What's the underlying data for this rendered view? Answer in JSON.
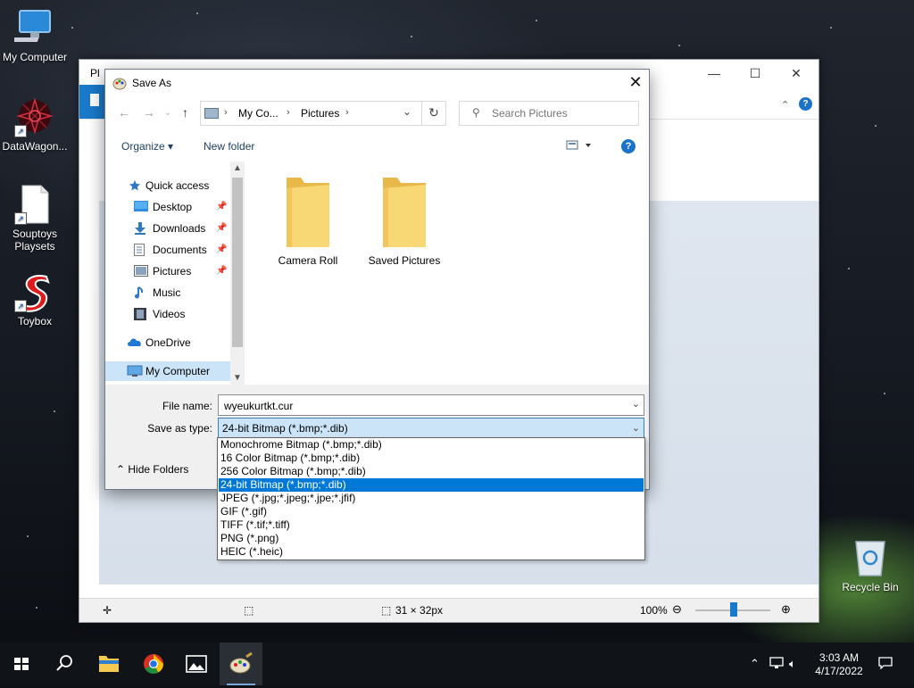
{
  "desktop": {
    "icons": [
      {
        "label": "My Computer"
      },
      {
        "label": "DataWagon..."
      },
      {
        "label": "Souptoys Playsets"
      },
      {
        "label": "Toybox"
      }
    ],
    "recycle_bin": "Recycle Bin"
  },
  "paint": {
    "title": "Pl",
    "status_size": "31 × 32px",
    "zoom": "100%"
  },
  "dialog": {
    "title": "Save As",
    "breadcrumb": [
      "My Co...",
      "Pictures"
    ],
    "search_placeholder": "Search Pictures",
    "organize": "Organize",
    "new_folder": "New folder",
    "nav": [
      {
        "label": "Quick access"
      },
      {
        "label": "Desktop"
      },
      {
        "label": "Downloads"
      },
      {
        "label": "Documents"
      },
      {
        "label": "Pictures"
      },
      {
        "label": "Music"
      },
      {
        "label": "Videos"
      },
      {
        "label": "OneDrive"
      },
      {
        "label": "My Computer"
      }
    ],
    "folders": [
      {
        "label": "Camera Roll"
      },
      {
        "label": "Saved Pictures"
      }
    ],
    "file_name_label": "File name:",
    "file_name_value": "wyeukurtkt.cur",
    "save_type_label": "Save as type:",
    "save_type_value": "24-bit Bitmap (*.bmp;*.dib)",
    "hide_folders": "Hide Folders",
    "type_options": [
      "Monochrome Bitmap (*.bmp;*.dib)",
      "16 Color Bitmap (*.bmp;*.dib)",
      "256 Color Bitmap (*.bmp;*.dib)",
      "24-bit Bitmap (*.bmp;*.dib)",
      "JPEG (*.jpg;*.jpeg;*.jpe;*.jfif)",
      "GIF (*.gif)",
      "TIFF (*.tif;*.tiff)",
      "PNG (*.png)",
      "HEIC (*.heic)"
    ],
    "selected_option_index": 3
  },
  "taskbar": {
    "time": "3:03 AM",
    "date": "4/17/2022"
  },
  "colors": {
    "accent": "#0078d7",
    "folder": "#f5c95c",
    "selection": "#cce4f7"
  }
}
